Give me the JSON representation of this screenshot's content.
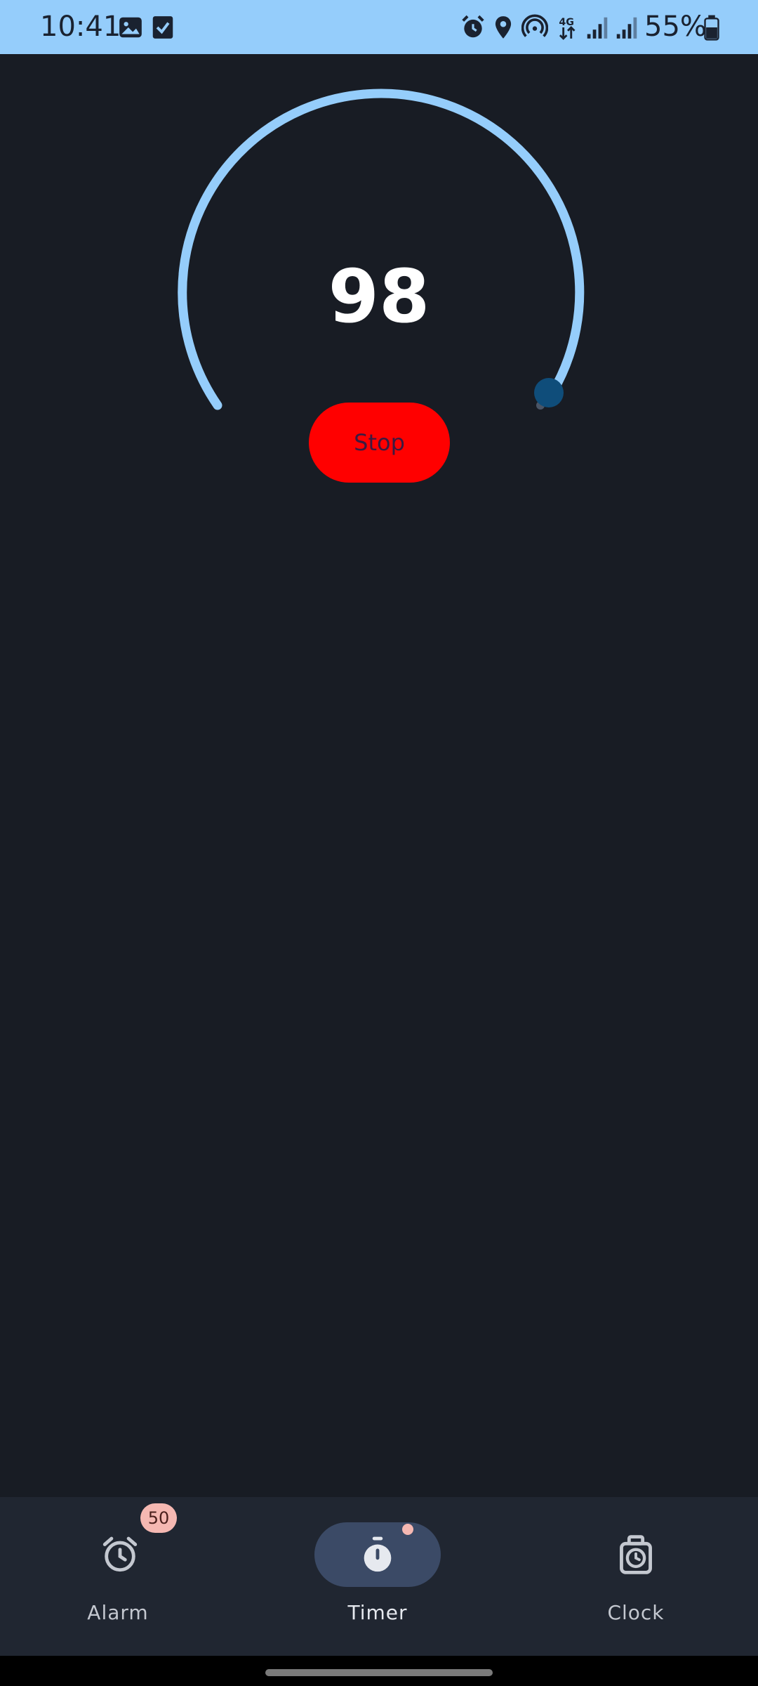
{
  "status_bar": {
    "time": "10:41",
    "battery": "55%",
    "left_icons": [
      "image-icon",
      "checkbox-icon"
    ],
    "right_icons": [
      "alarm-icon",
      "location-icon",
      "hotspot-icon",
      "4g-data-icon",
      "signal-icon",
      "signal-icon",
      "battery-icon"
    ],
    "network_label": "4G"
  },
  "timer": {
    "value": "98",
    "stop_label": "Stop",
    "arc_color": "#95cdfb",
    "handle_color": "#0f4d7a"
  },
  "bottom_nav": {
    "items": [
      {
        "label": "Alarm",
        "icon": "alarm-clock-icon",
        "badge": "50",
        "active": false
      },
      {
        "label": "Timer",
        "icon": "stopwatch-icon",
        "active": true
      },
      {
        "label": "Clock",
        "icon": "clock-icon",
        "active": false
      }
    ]
  },
  "colors": {
    "background": "#181c24",
    "status_bar": "#95cdfb",
    "stop_button": "#ff0000",
    "nav_background": "#202631",
    "badge": "#f5b8b2"
  }
}
